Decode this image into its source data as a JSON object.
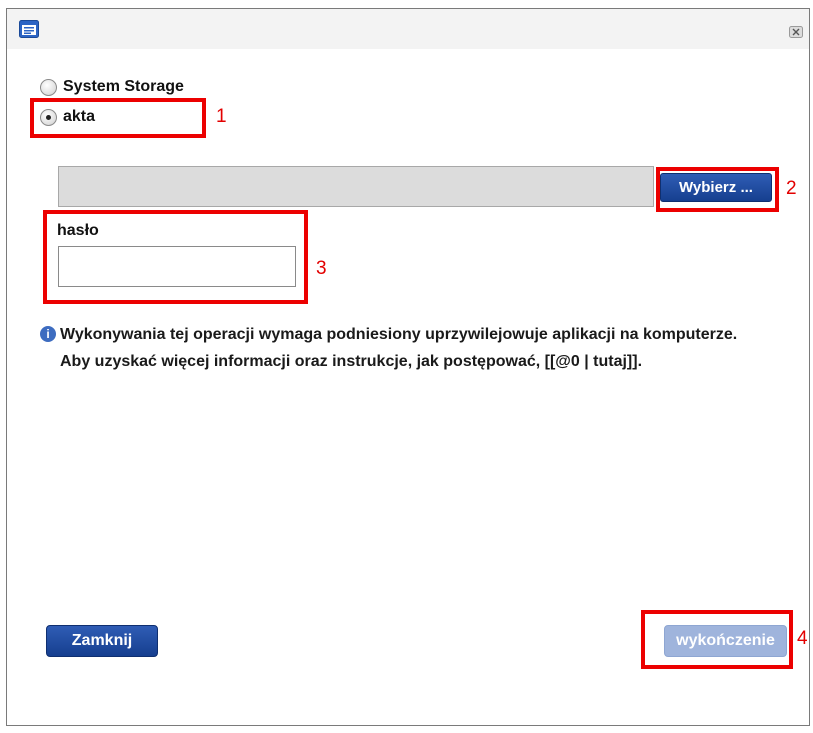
{
  "dialog": {
    "icon": "window-icon",
    "close_icon": "close-icon"
  },
  "options": [
    {
      "label": "System Storage",
      "selected": false
    },
    {
      "label": "akta",
      "selected": true
    }
  ],
  "file_picker": {
    "value": "",
    "button_label": "Wybierz ..."
  },
  "password": {
    "label": "hasło",
    "value": ""
  },
  "info": {
    "icon": "info-icon",
    "glyph": "i",
    "text": "Wykonywania tej operacji wymaga podniesiony uprzywilejowuje aplikacji na komputerze. Aby uzyskać więcej informacji oraz instrukcje, jak postępować, [[@0 | tutaj]]."
  },
  "buttons": {
    "close_label": "Zamknij",
    "finish_label": "wykończenie"
  },
  "annotations": {
    "color": "#ec0000",
    "labels": [
      "1",
      "2",
      "3",
      "4"
    ]
  },
  "colors": {
    "primary_button": "#1f4a9e",
    "disabled_button": "#9fb4dc"
  }
}
